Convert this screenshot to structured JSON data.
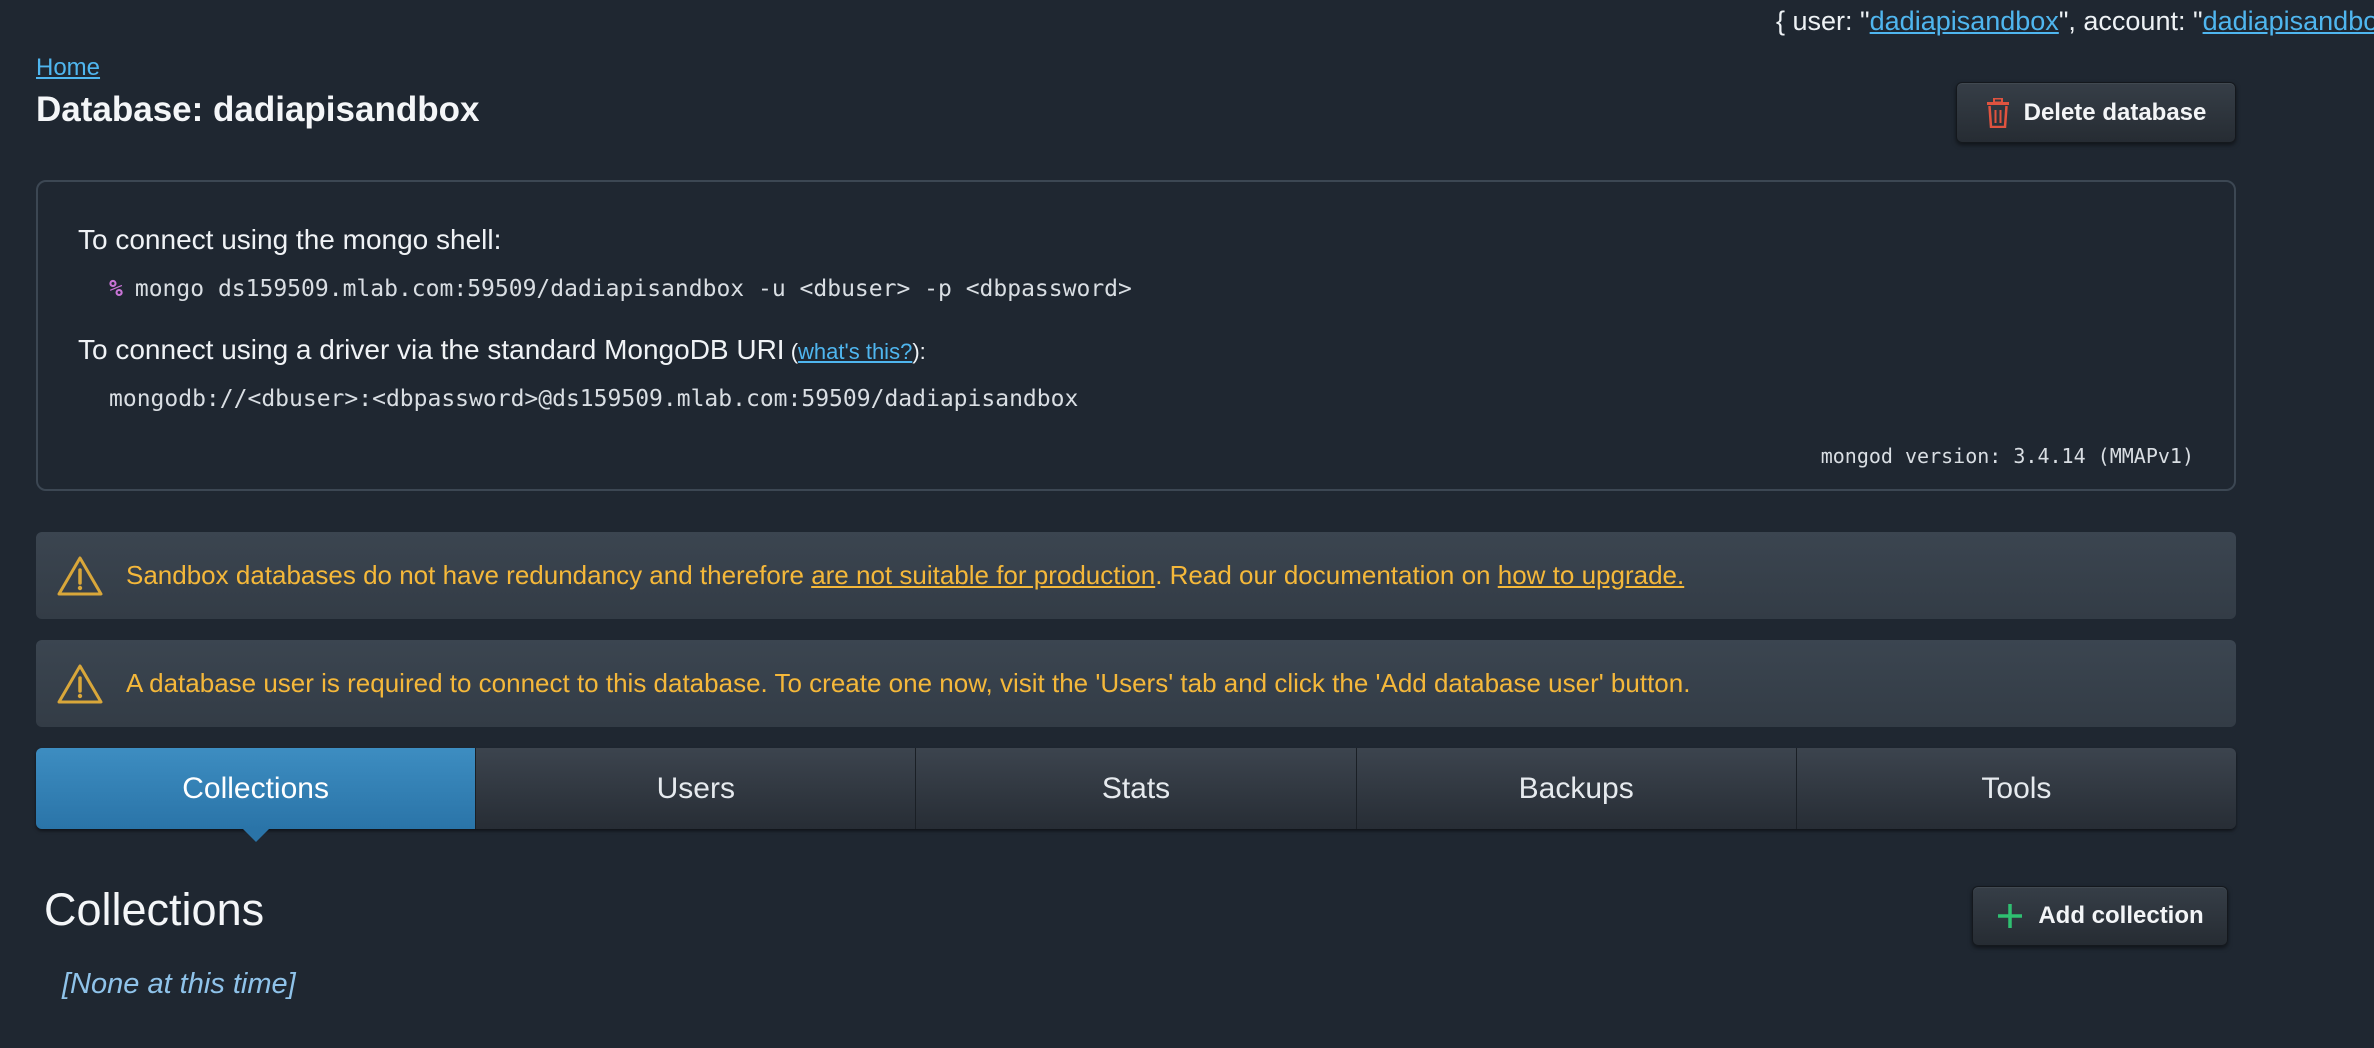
{
  "header": {
    "user_prefix": "{ user: \"",
    "user": "dadiapisandbox",
    "account_prefix": "\", account: \"",
    "account": "dadiapisandbox",
    "breadcrumb_home": "Home",
    "title": "Database: dadiapisandbox",
    "delete_label": "Delete database"
  },
  "connect": {
    "shell_text": "To connect using the mongo shell:",
    "shell_prompt": "%",
    "shell_cmd": "mongo ds159509.mlab.com:59509/dadiapisandbox -u <dbuser> -p <dbpassword>",
    "driver_text": "To connect using a driver via the standard MongoDB URI",
    "driver_open": " (",
    "driver_link": "what's this?",
    "driver_close": "):",
    "uri": "mongodb://<dbuser>:<dbpassword>@ds159509.mlab.com:59509/dadiapisandbox",
    "version": "mongod version: 3.4.14 (MMAPv1)"
  },
  "alerts": {
    "a1_pre": "Sandbox databases do not have redundancy and therefore ",
    "a1_link1": "are not suitable for production",
    "a1_mid": ". Read our documentation on ",
    "a1_link2": "how to upgrade.",
    "a2": "A database user is required to connect to this database. To create one now, visit the 'Users' tab and click the 'Add database user' button."
  },
  "tabs": [
    "Collections",
    "Users",
    "Stats",
    "Backups",
    "Tools"
  ],
  "collections": {
    "title": "Collections",
    "add_label": "Add collection",
    "empty": "[None at this time]"
  },
  "colors": {
    "background": "#1f2731",
    "accent": "#2a74a8",
    "warning": "#f5b83a",
    "link": "#4fb6ef",
    "delete_icon": "#e0533f",
    "add_icon": "#2fbf71"
  },
  "icons": [
    "trash-icon",
    "warning-icon",
    "plus-icon"
  ]
}
